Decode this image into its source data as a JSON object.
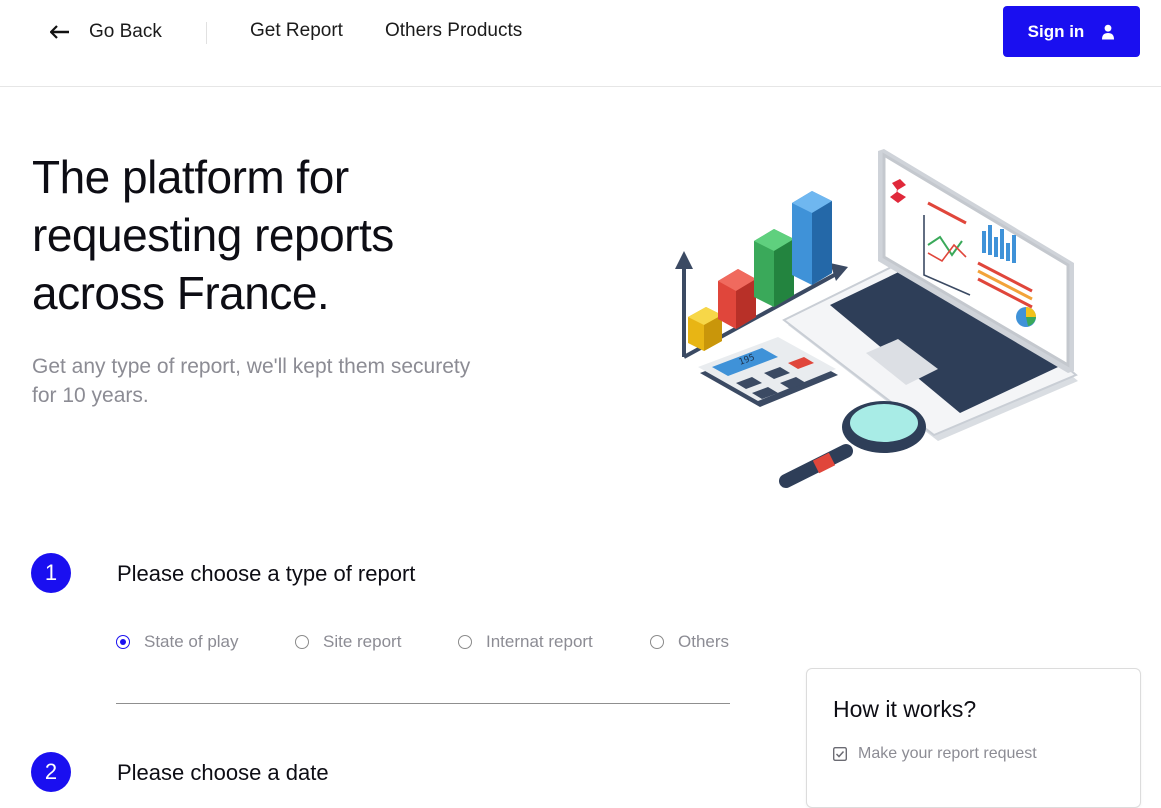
{
  "nav": {
    "back_label": "Go Back",
    "links": [
      "Get Report",
      "Others Products"
    ],
    "signin_label": "Sign in"
  },
  "hero": {
    "title": "The platform for requesting reports across France.",
    "subtitle": "Get any type of report, we'll kept them securety for 10 years.",
    "calculator_display": "195"
  },
  "steps": [
    {
      "number": "1",
      "title": "Please choose a type of report",
      "options": [
        "State of play",
        "Site report",
        "Internat report",
        "Others"
      ],
      "selected": "State of play"
    },
    {
      "number": "2",
      "title": "Please choose a date"
    }
  ],
  "how_it_works": {
    "title": "How it works?",
    "items": [
      "Make your report request"
    ]
  },
  "colors": {
    "accent": "#1a0ff0",
    "muted_text": "#8c8c94"
  },
  "icons": [
    "arrow-left-icon",
    "user-icon",
    "radio-icon",
    "checkbox-icon"
  ]
}
